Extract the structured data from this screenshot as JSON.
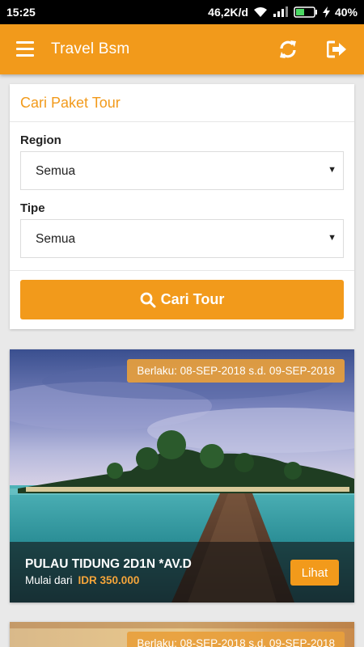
{
  "status_bar": {
    "time": "15:25",
    "network_speed": "46,2K/d",
    "battery_percent": "40%",
    "icons": [
      "wifi-icon",
      "signal-icon",
      "battery-icon",
      "charging-bolt-icon"
    ]
  },
  "app_bar": {
    "title": "Travel Bsm",
    "icons": [
      "menu-icon",
      "refresh-icon",
      "logout-icon"
    ]
  },
  "search_card": {
    "title": "Cari Paket Tour",
    "region_label": "Region",
    "region_value": "Semua",
    "type_label": "Tipe",
    "type_value": "Semua",
    "search_button_label": "Cari Tour",
    "search_button_icon": "search-icon"
  },
  "tours": [
    {
      "validity": "Berlaku: 08-SEP-2018 s.d. 09-SEP-2018",
      "name": "PULAU TIDUNG 2D1N *AV.D",
      "price_prefix": "Mulai dari",
      "price": "IDR 350.000",
      "view_label": "Lihat"
    },
    {
      "validity": "Berlaku: 08-SEP-2018 s.d. 09-SEP-2018"
    }
  ],
  "colors": {
    "accent": "#f29a1b",
    "price": "#f5a53a",
    "background": "#e9e9e9"
  }
}
